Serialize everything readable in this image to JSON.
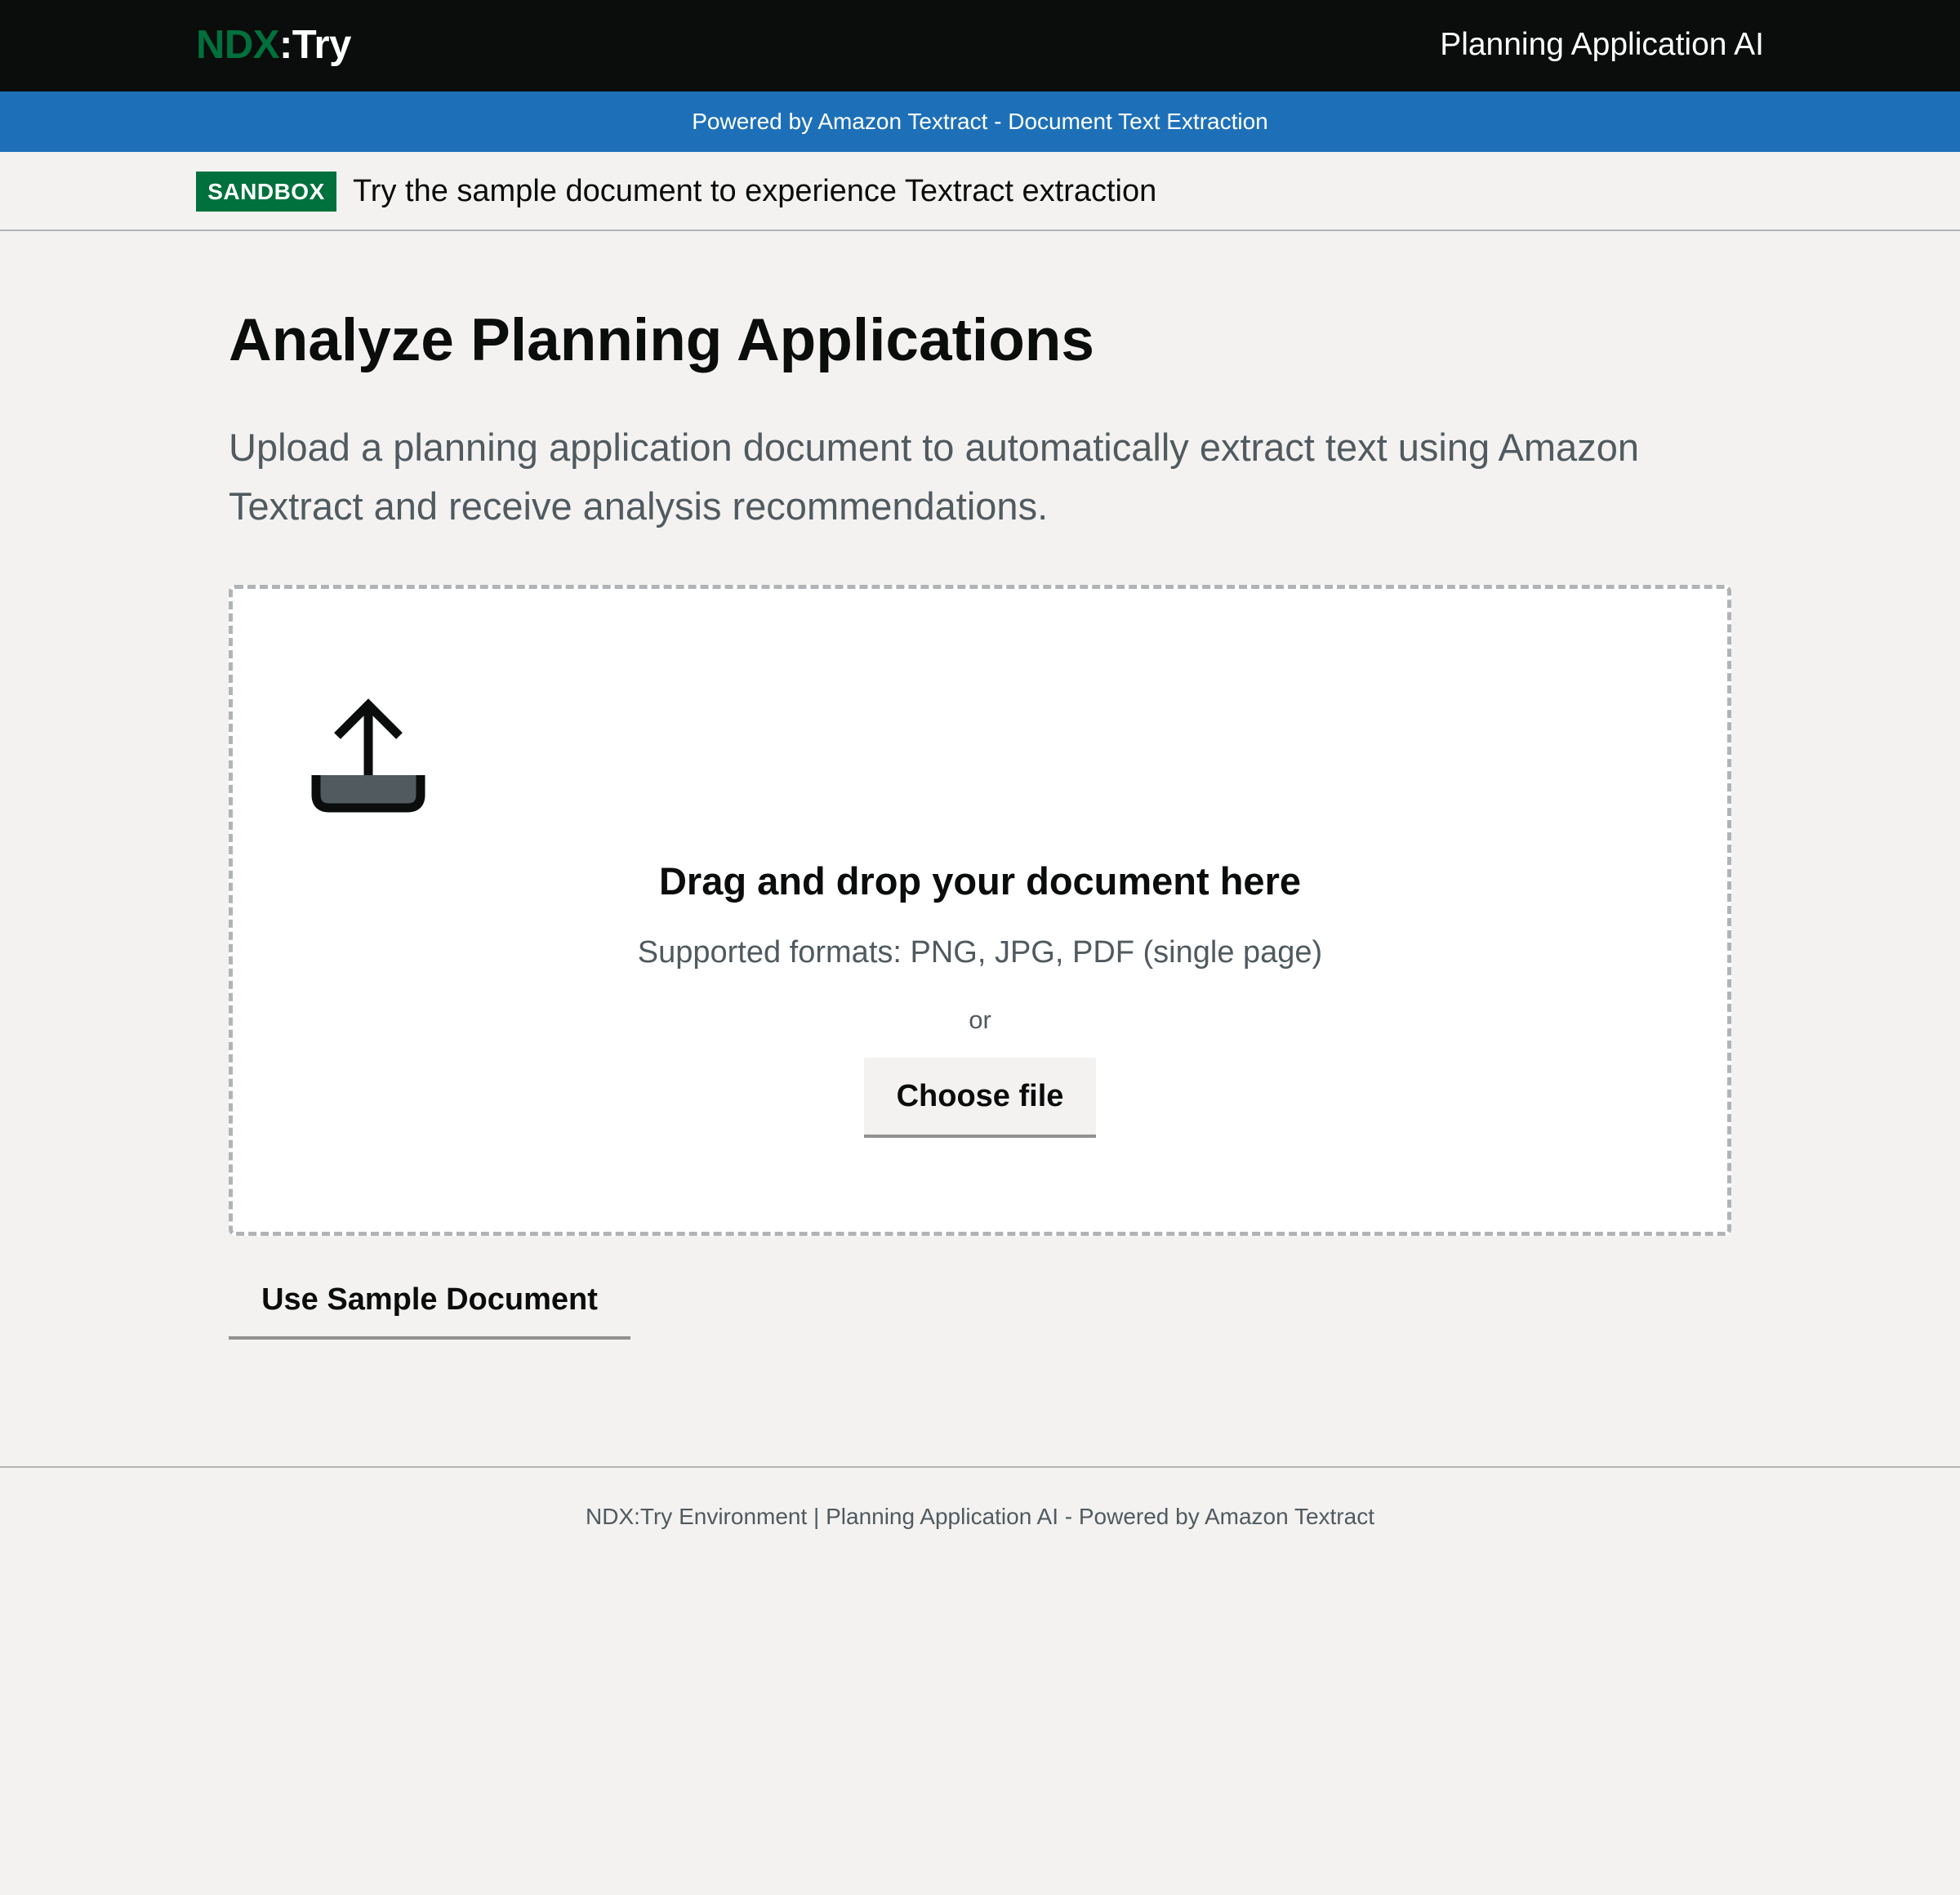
{
  "header": {
    "logo_primary": "NDX",
    "logo_secondary": ":Try",
    "service_name": "Planning Application AI"
  },
  "banner": {
    "text": "Powered by Amazon Textract - Document Text Extraction"
  },
  "phase": {
    "tag": "SANDBOX",
    "text": "Try the sample document to experience Textract extraction"
  },
  "main": {
    "title": "Analyze Planning Applications",
    "lead": "Upload a planning application document to automatically extract text using Amazon Textract and receive analysis recommendations."
  },
  "dropzone": {
    "icon": "upload-icon",
    "title": "Drag and drop your document here",
    "formats": "Supported formats: PNG, JPG, PDF (single page)",
    "or": "or",
    "choose_label": "Choose file"
  },
  "actions": {
    "sample_label": "Use Sample Document"
  },
  "footer": {
    "text": "NDX:Try Environment | Planning Application AI - Powered by Amazon Textract"
  },
  "colors": {
    "header_bg": "#0b0c0c",
    "brand_green": "#00703c",
    "banner_blue": "#1d70b8",
    "page_bg": "#f3f2f1",
    "secondary_text": "#505a5f"
  }
}
